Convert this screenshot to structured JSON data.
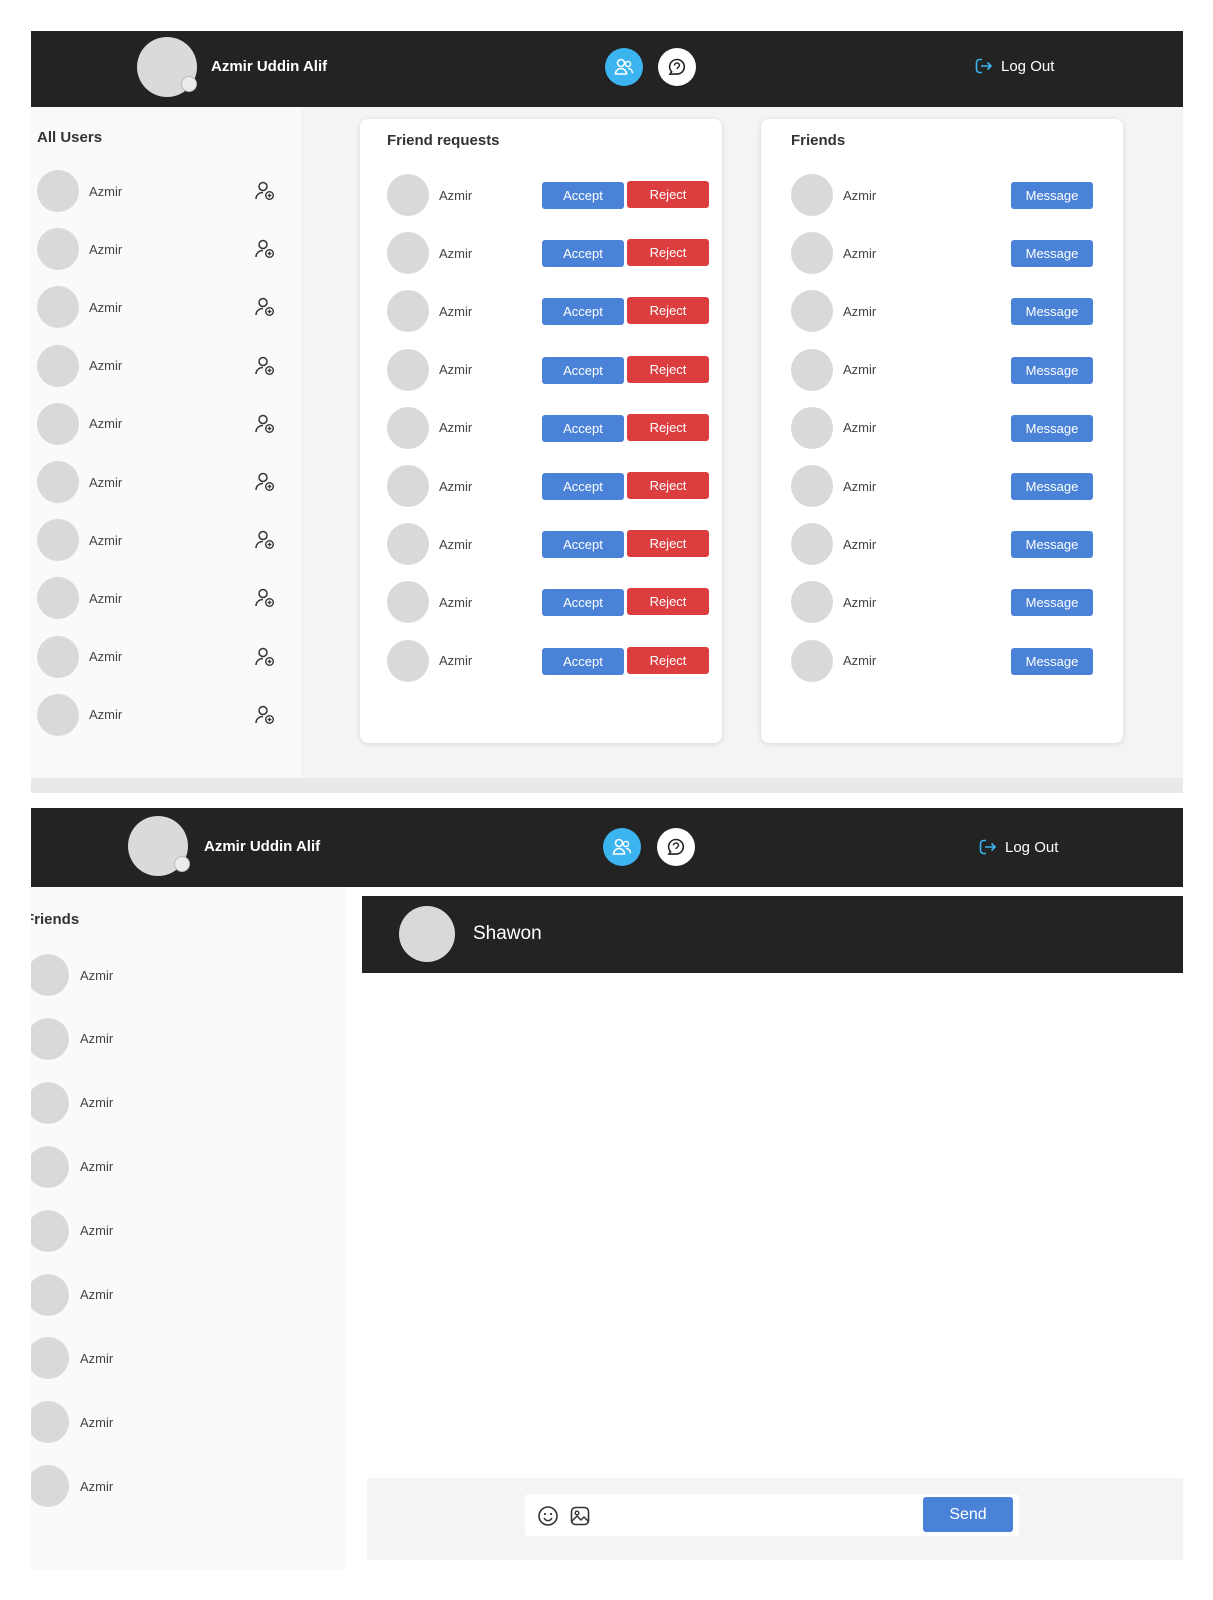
{
  "app": {
    "user_name": "Azmir Uddin Alif",
    "logout_label": "Log Out",
    "colors": {
      "topbar": "#222322",
      "accent_blue": "#4a82d8",
      "nav_active": "#3bb4f0",
      "reject_red": "#dc3d3f"
    }
  },
  "screen1": {
    "all_users": {
      "title": "All Users",
      "items": [
        {
          "name": "Azmir",
          "icon": "add-friend-icon"
        },
        {
          "name": "Azmir",
          "icon": "add-friend-icon"
        },
        {
          "name": "Azmir",
          "icon": "add-friend-icon"
        },
        {
          "name": "Azmir",
          "icon": "add-friend-icon"
        },
        {
          "name": "Azmir",
          "icon": "add-friend-icon"
        },
        {
          "name": "Azmir",
          "icon": "add-friend-icon"
        },
        {
          "name": "Azmir",
          "icon": "add-friend-icon"
        },
        {
          "name": "Azmir",
          "icon": "add-friend-icon"
        },
        {
          "name": "Azmir",
          "icon": "add-friend-icon"
        },
        {
          "name": "Azmir",
          "icon": "add-friend-icon"
        }
      ]
    },
    "friend_requests": {
      "title": "Friend requests",
      "accept_label": "Accept",
      "reject_label": "Reject",
      "items": [
        {
          "name": "Azmir"
        },
        {
          "name": "Azmir"
        },
        {
          "name": "Azmir"
        },
        {
          "name": "Azmir"
        },
        {
          "name": "Azmir"
        },
        {
          "name": "Azmir"
        },
        {
          "name": "Azmir"
        },
        {
          "name": "Azmir"
        },
        {
          "name": "Azmir"
        }
      ]
    },
    "friends": {
      "title": "Friends",
      "message_label": "Message",
      "items": [
        {
          "name": "Azmir"
        },
        {
          "name": "Azmir"
        },
        {
          "name": "Azmir"
        },
        {
          "name": "Azmir"
        },
        {
          "name": "Azmir"
        },
        {
          "name": "Azmir"
        },
        {
          "name": "Azmir"
        },
        {
          "name": "Azmir"
        },
        {
          "name": "Azmir"
        }
      ]
    }
  },
  "screen2": {
    "friends": {
      "title": "Friends",
      "items": [
        {
          "name": "Azmir"
        },
        {
          "name": "Azmir"
        },
        {
          "name": "Azmir"
        },
        {
          "name": "Azmir"
        },
        {
          "name": "Azmir"
        },
        {
          "name": "Azmir"
        },
        {
          "name": "Azmir"
        },
        {
          "name": "Azmir"
        },
        {
          "name": "Azmir"
        }
      ]
    },
    "chat": {
      "contact_name": "Shawon",
      "send_label": "Send",
      "input_value": ""
    }
  }
}
